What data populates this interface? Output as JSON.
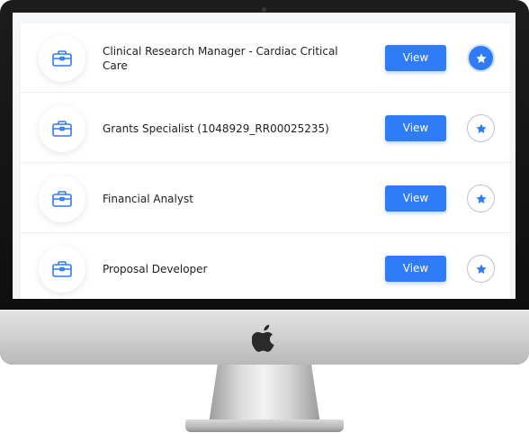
{
  "jobs": [
    {
      "title": "Clinical Research Manager - Cardiac Critical Care",
      "button_label": "View",
      "favorited": true
    },
    {
      "title": "Grants Specialist (1048929_RR00025235)",
      "button_label": "View",
      "favorited": false
    },
    {
      "title": "Financial Analyst",
      "button_label": "View",
      "favorited": false
    },
    {
      "title": "Proposal Developer",
      "button_label": "View",
      "favorited": false
    }
  ],
  "icons": {
    "job": "briefcase-icon",
    "favorite": "star-icon",
    "brand": "apple-logo-icon"
  },
  "colors": {
    "accent": "#2f7cf6",
    "text": "#1f1f1f",
    "divider": "#ececec"
  }
}
